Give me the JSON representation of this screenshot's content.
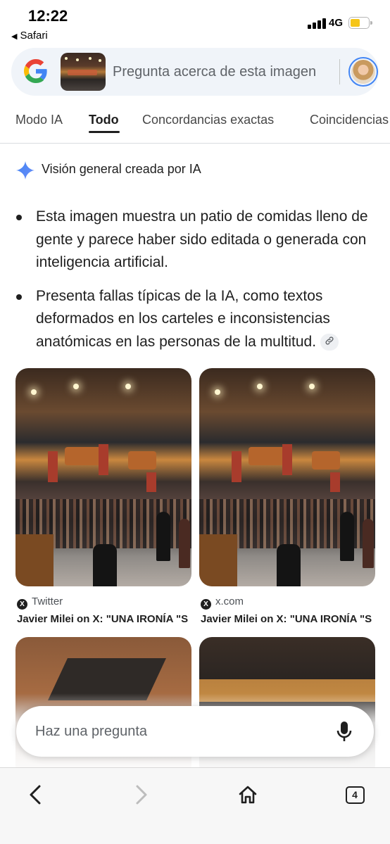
{
  "status_bar": {
    "time": "12:22",
    "back_app": "Safari",
    "network": "4G",
    "battery_level_percent": 55,
    "battery_color": "#f5c518"
  },
  "search": {
    "placeholder": "Pregunta acerca de esta imagen",
    "logo_icon": "google-g-icon",
    "thumbnail_icon": "food-court-thumbnail",
    "avatar_icon": "user-avatar"
  },
  "tabs": [
    {
      "label": "Modo IA",
      "active": false
    },
    {
      "label": "Todo",
      "active": true
    },
    {
      "label": "Concordancias exactas",
      "active": false
    },
    {
      "label": "Coincidencias",
      "active": false
    }
  ],
  "ai_overview": {
    "icon": "gemini-sparkle-icon",
    "title": "Visión general creada por IA",
    "bullets": [
      "Esta imagen muestra un patio de comidas lleno de gente y parece haber sido editada o generada con inteligencia artificial.",
      "Presenta fallas típicas de la IA, como textos deformados en los carteles e inconsistencias anatómicas en las personas de la multitud."
    ],
    "link_icon": "link-icon"
  },
  "results": [
    {
      "source": "Twitter",
      "source_icon": "x-logo-icon",
      "title": "Javier Milei on X: \"UNA IRONÍA \"S"
    },
    {
      "source": "x.com",
      "source_icon": "x-logo-icon",
      "title": "Javier Milei on X: \"UNA IRONÍA \"S"
    }
  ],
  "ask": {
    "placeholder": "Haz una pregunta",
    "mic_icon": "microphone-icon"
  },
  "toolbar": {
    "back_icon": "chevron-left-icon",
    "forward_icon": "chevron-right-icon",
    "home_icon": "home-icon",
    "tab_count": "4"
  },
  "colors": {
    "accent_blue": "#4285f4",
    "search_bg": "#f0f4f9",
    "text": "#1f1f1f"
  }
}
